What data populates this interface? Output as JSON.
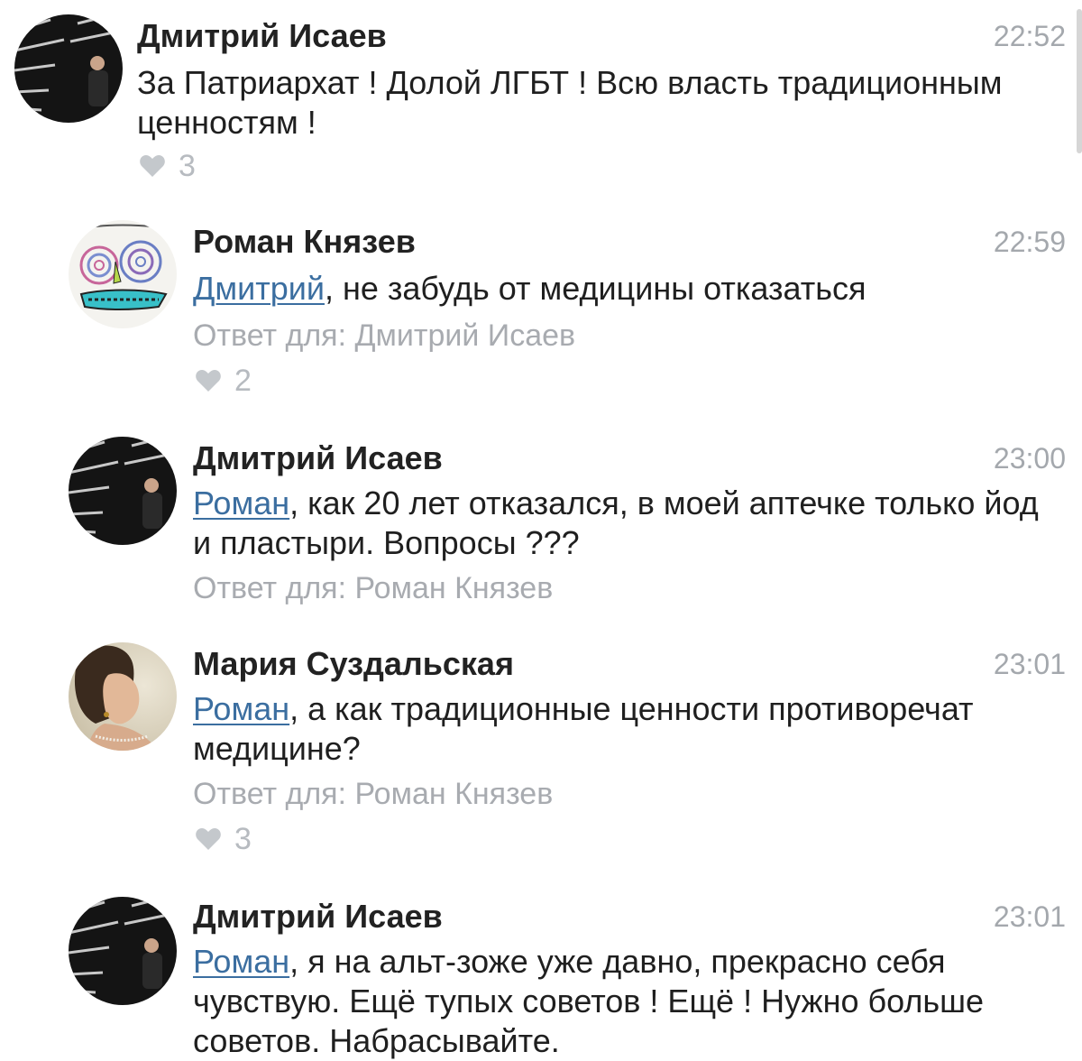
{
  "comments": [
    {
      "author": "Дмитрий Исаев",
      "time": "22:52",
      "mention": "",
      "text": "За Патриархат ! Долой ЛГБТ ! Всю власть традиционным ценностям !",
      "reply_to": "",
      "likes": "3",
      "avatar": "dmitry-avatar"
    },
    {
      "author": "Роман Князев",
      "time": "22:59",
      "mention": "Дмитрий",
      "text": ", не забудь от медицины отказаться",
      "reply_to": "Ответ для: Дмитрий Исаев",
      "likes": "2",
      "avatar": "roman-avatar"
    },
    {
      "author": "Дмитрий Исаев",
      "time": "23:00",
      "mention": "Роман",
      "text": ", как 20 лет отказался, в моей аптечке только йод и пластыри. Вопросы ???",
      "reply_to": "Ответ для: Роман Князев",
      "likes": "",
      "avatar": "dmitry-avatar"
    },
    {
      "author": "Мария Суздальская",
      "time": "23:01",
      "mention": "Роман",
      "text": ", а как традиционные ценности противоречат медицине?",
      "reply_to": "Ответ для: Роман Князев",
      "likes": "3",
      "avatar": "maria-avatar"
    },
    {
      "author": "Дмитрий Исаев",
      "time": "23:01",
      "mention": "Роман",
      "text": ", я на альт-зоже уже давно, прекрасно себя чувствую. Ещё тупых советов ! Ещё ! Нужно больше советов. Набрасывайте.",
      "reply_to": "",
      "likes": "",
      "avatar": "dmitry-avatar"
    }
  ],
  "colors": {
    "mention": "#3b6ea0",
    "meta": "#a8abb0",
    "author": "#222222"
  }
}
